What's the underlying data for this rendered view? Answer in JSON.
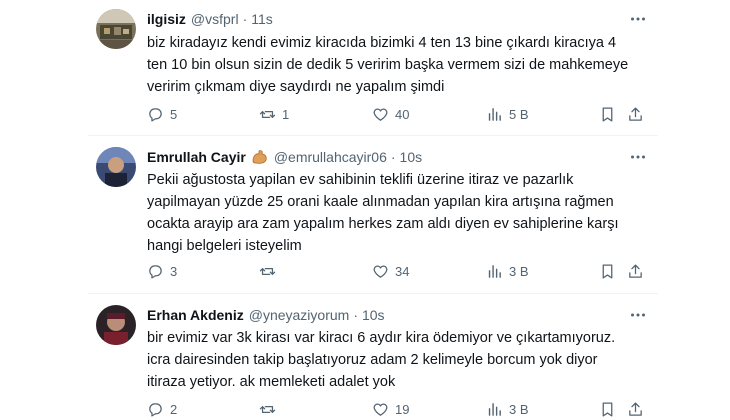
{
  "tweets": [
    {
      "name": "ilgisiz",
      "handle": "@vsfprl",
      "separator": "·",
      "time": "11s",
      "emoji": "",
      "lines": [
        "biz kiradayız kendi evimiz kiracıda bizimki 4 ten 13 bine çıkardı kiracıya 4",
        "ten 10 bin olsun sizin de dedik 5 veririm başka vermem sizi de mahkemeye",
        "veririm çıkmam diye saydırdı ne yapalım şimdi"
      ],
      "replies": "5",
      "retweets": "1",
      "likes": "40",
      "views": "5 B"
    },
    {
      "name": "Emrullah Cayir",
      "handle": "@emrullahcayir06",
      "separator": "·",
      "time": "10s",
      "emoji": "flexed-biceps-icon",
      "lines": [
        "Pekii ağustosta yapilan ev sahibinin teklifi üzerine itiraz ve pazarlık",
        "yapilmayan yüzde 25 orani kaale alınmadan yapılan kira artışına rağmen",
        "ocakta arayip ara zam yapalım herkes zam aldı diyen  ev sahiplerine karşı",
        "hangi belgeleri isteyelim"
      ],
      "replies": "3",
      "retweets": "",
      "likes": "34",
      "views": "3 B"
    },
    {
      "name": "Erhan Akdeniz",
      "handle": "@yneyaziyorum",
      "separator": "·",
      "time": "10s",
      "emoji": "",
      "lines": [
        "bir evimiz var 3k kirası var kiracı 6 aydır kira ödemiyor ve çıkartamıyoruz.",
        "icra dairesinden takip başlatıyoruz adam 2 kelimeyle borcum yok diyor",
        "itiraza yetiyor. ak memleketi adalet yok"
      ],
      "replies": "2",
      "retweets": "",
      "likes": "19",
      "views": "3 B"
    }
  ],
  "colors": {
    "text": "#0f1419",
    "muted": "#536471",
    "divider": "#eff3f4"
  }
}
